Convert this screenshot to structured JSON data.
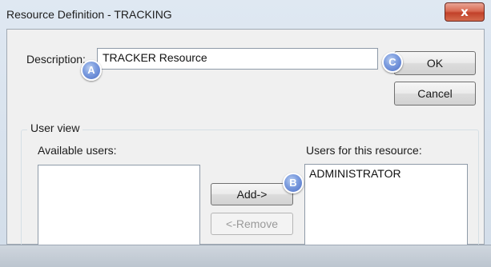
{
  "window": {
    "title": "Resource Definition - TRACKING",
    "close_symbol": "x"
  },
  "description": {
    "label": "Description:",
    "value": "TRACKER Resource"
  },
  "buttons": {
    "ok": "OK",
    "cancel": "Cancel",
    "add": "Add->",
    "remove": "<-Remove"
  },
  "user_view": {
    "title": "User view",
    "available_label": "Available users:",
    "resource_label": "Users for this resource:",
    "available_users": [],
    "resource_users": [
      "ADMINISTRATOR"
    ]
  },
  "markers": {
    "a": "A",
    "b": "B",
    "c": "C"
  },
  "colors": {
    "marker": "#5b7fd0",
    "close": "#c94a33"
  }
}
